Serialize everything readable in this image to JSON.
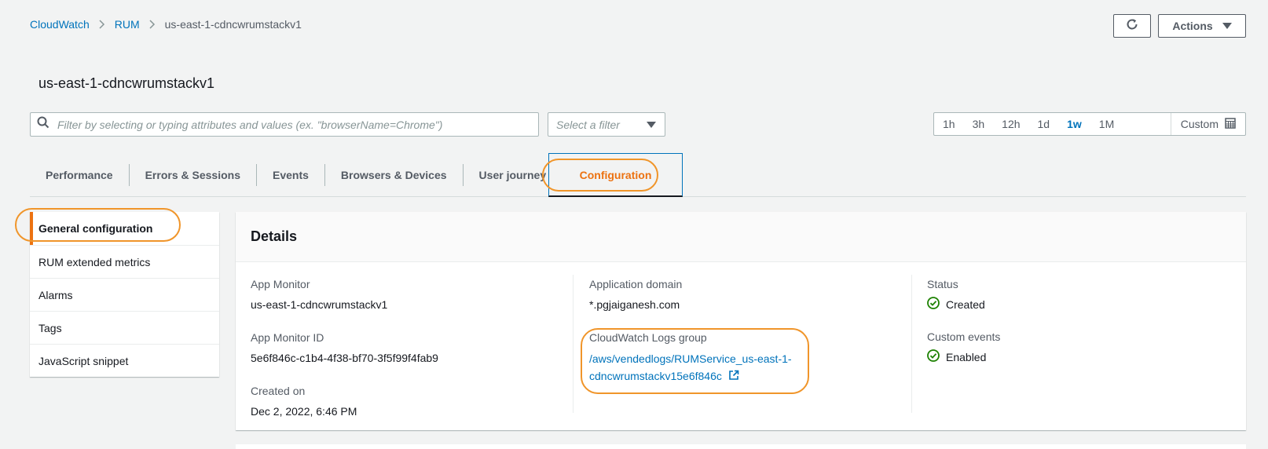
{
  "breadcrumb": {
    "items": [
      "CloudWatch",
      "RUM",
      "us-east-1-cdncwrumstackv1"
    ]
  },
  "header": {
    "actions_label": "Actions",
    "refresh_icon": "refresh-icon"
  },
  "page": {
    "title": "us-east-1-cdncwrumstackv1"
  },
  "filter": {
    "search_placeholder": "Filter by selecting or typing attributes and values (ex. \"browserName=Chrome\")",
    "select_placeholder": "Select a filter"
  },
  "time_range": {
    "options": [
      "1h",
      "3h",
      "12h",
      "1d",
      "1w",
      "1M"
    ],
    "selected": "1w",
    "custom_label": "Custom"
  },
  "tabs": {
    "items": [
      "Performance",
      "Errors & Sessions",
      "Events",
      "Browsers & Devices",
      "User journey",
      "Configuration"
    ],
    "active": "Configuration"
  },
  "side_nav": {
    "items": [
      "General configuration",
      "RUM extended metrics",
      "Alarms",
      "Tags",
      "JavaScript snippet"
    ],
    "active": "General configuration"
  },
  "details": {
    "title": "Details",
    "app_monitor_label": "App Monitor",
    "app_monitor_value": "us-east-1-cdncwrumstackv1",
    "app_monitor_id_label": "App Monitor ID",
    "app_monitor_id_value": "5e6f846c-c1b4-4f38-bf70-3f5f99f4fab9",
    "created_on_label": "Created on",
    "created_on_value": "Dec 2, 2022, 6:46 PM",
    "app_domain_label": "Application domain",
    "app_domain_value": "*.pgjaiganesh.com",
    "logs_group_label": "CloudWatch Logs group",
    "logs_group_value": "/aws/vendedlogs/RUMService_us-east-1-cdncwrumstackv15e6f846c",
    "status_label": "Status",
    "status_value": "Created",
    "custom_events_label": "Custom events",
    "custom_events_value": "Enabled"
  },
  "colors": {
    "link": "#0073bb",
    "accent_orange": "#ec7211",
    "highlight_orange": "#f0952a",
    "success_green": "#1d8102"
  }
}
